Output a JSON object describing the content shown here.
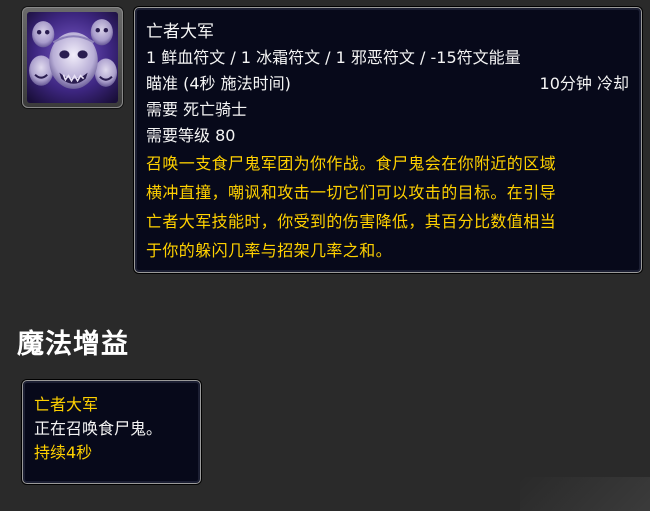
{
  "spell": {
    "icon": "army-of-the-dead-icon",
    "name": "亡者大军",
    "cost_line": "1 鲜血符文 / 1 冰霜符文 / 1 邪恶符文 / -15符文能量",
    "cast": "瞄准 (4秒 施法时间)",
    "cooldown": "10分钟 冷却",
    "requires_class": "需要 死亡骑士",
    "requires_level": "需要等级 80",
    "description_lines": [
      "召唤一支食尸鬼军团为你作战。食尸鬼会在你附近的区域",
      "横冲直撞，嘲讽和攻击一切它们可以攻击的目标。在引导",
      "亡者大军技能时，你受到的伤害降低，其百分比数值相当",
      "于你的躲闪几率与招架几率之和。"
    ]
  },
  "buffs": {
    "section_title": "魔法增益",
    "items": [
      {
        "name": "亡者大军",
        "description": "正在召唤食尸鬼。",
        "duration": "持续4秒"
      }
    ]
  },
  "colors": {
    "tooltip_bg": "#07091a",
    "gold_text": "#ffd100",
    "white_text": "#f4f4f4",
    "page_bg": "#2a2a2a"
  }
}
